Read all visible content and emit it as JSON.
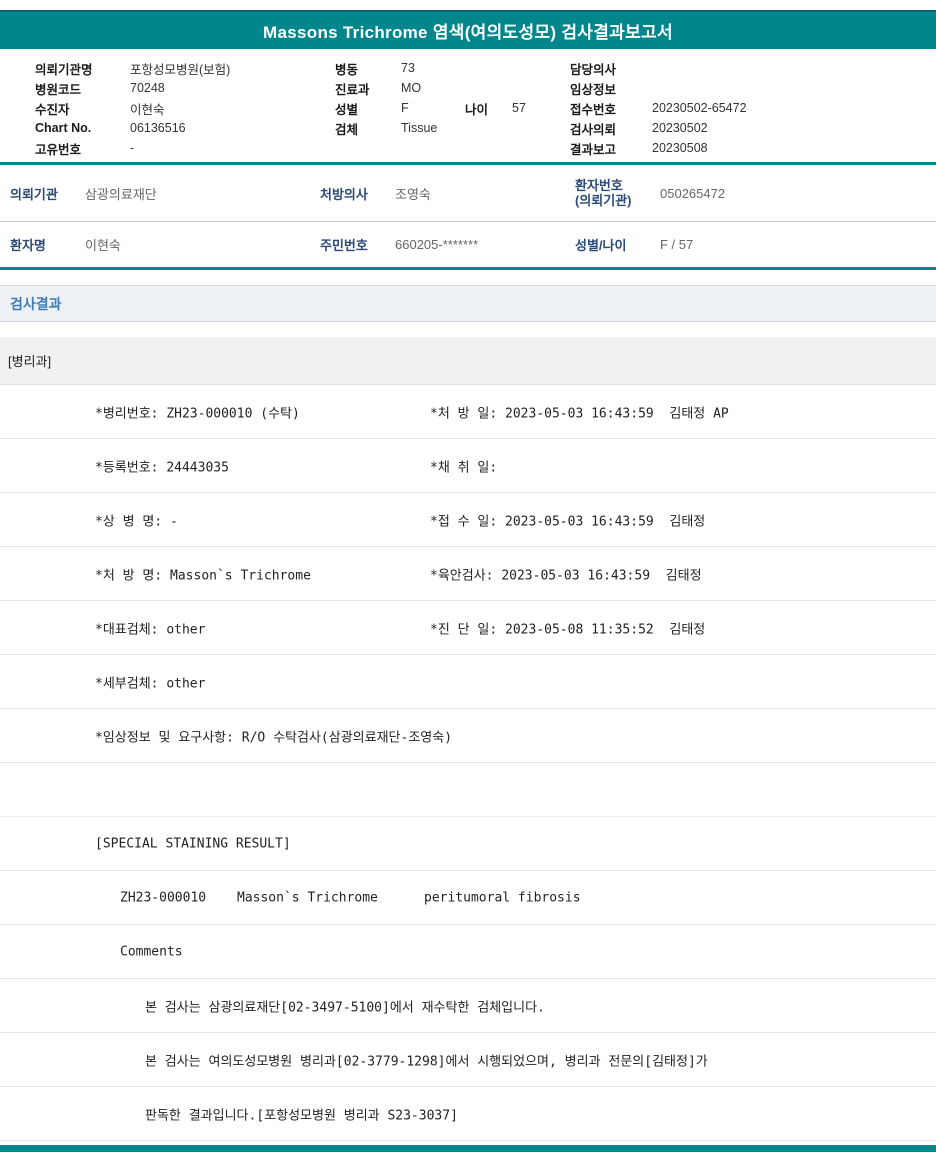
{
  "report": {
    "title": "Massons Trichrome 염색(여의도성모) 검사결과보고서"
  },
  "colors": {
    "accent_teal": "#00868B",
    "section_title_blue": "#3F7CB6",
    "section_bar_bg": "#EDF1F6",
    "dept_bar_bg": "#F1F1F1"
  },
  "top_info": {
    "col1": [
      {
        "label": "의뢰기관명",
        "value": "포항성모병원(보험)"
      },
      {
        "label": "병원코드",
        "value": "70248"
      },
      {
        "label": "수진자",
        "value": "이현숙"
      },
      {
        "label": "Chart No.",
        "value": "06136516"
      },
      {
        "label": "고유번호",
        "value": "-"
      }
    ],
    "col2": [
      {
        "label": "병동",
        "value": "73"
      },
      {
        "label": "진료과",
        "value": "MO"
      },
      {
        "label": "성별",
        "value": "F"
      },
      {
        "label": "검체",
        "value": "Tissue"
      }
    ],
    "age_label": "나이",
    "age_value": "57",
    "col3": [
      {
        "label": "담당의사",
        "value": ""
      },
      {
        "label": "임상정보",
        "value": ""
      },
      {
        "label": "접수번호",
        "value": "20230502-65472"
      },
      {
        "label": "검사의뢰",
        "value": "20230502"
      },
      {
        "label": "결과보고",
        "value": "20230508"
      }
    ]
  },
  "patient_table": {
    "row1": {
      "c1_label": "의뢰기관",
      "c1_value": "삼광의료재단",
      "c2_label": "처방의사",
      "c2_value": "조영숙",
      "c3_label": "환자번호\n(의뢰기관)",
      "c3_value": "050265472"
    },
    "row2": {
      "c1_label": "환자명",
      "c1_value": "이현숙",
      "c2_label": "주민번호",
      "c2_value": "660205-*******",
      "c3_label": "성별/나이",
      "c3_value": "F / 57"
    }
  },
  "results": {
    "section_title": "검사결과",
    "department": "[병리과]",
    "detail_rows": [
      {
        "left": "*병리번호: ZH23-000010 (수탁)",
        "right": "*처 방 일: 2023-05-03 16:43:59  김태정 AP"
      },
      {
        "left": "*등록번호: 24443035",
        "right": "*채 취 일:"
      },
      {
        "left": "*상 병 명: -",
        "right": "*접 수 일: 2023-05-03 16:43:59  김태정"
      },
      {
        "left": "*처 방 명: Masson`s Trichrome",
        "right": "*육안검사: 2023-05-03 16:43:59  김태정"
      },
      {
        "left": "*대표검체: other",
        "right": "*진 단 일: 2023-05-08 11:35:52  김태정"
      },
      {
        "left": "*세부검체: other",
        "right": ""
      },
      {
        "left": "*임상정보 및 요구사항: R/O 수탁검사(삼광의료재단-조영숙)",
        "right": ""
      }
    ],
    "staining_header": "[SPECIAL STAINING RESULT]",
    "staining_row": {
      "id": "ZH23-000010",
      "stain": "Masson`s Trichrome",
      "result": "peritumoral fibrosis"
    },
    "comments_label": "Comments",
    "comments": [
      "본 검사는 삼광의료재단[02-3497-5100]에서 재수탁한 검체입니다.",
      "본 검사는 여의도성모병원 병리과[02-3779-1298]에서 시행되었으며, 병리과 전문의[김태정]가",
      "판독한 결과입니다.[포항성모병원 병리과 S23-3037]"
    ]
  }
}
